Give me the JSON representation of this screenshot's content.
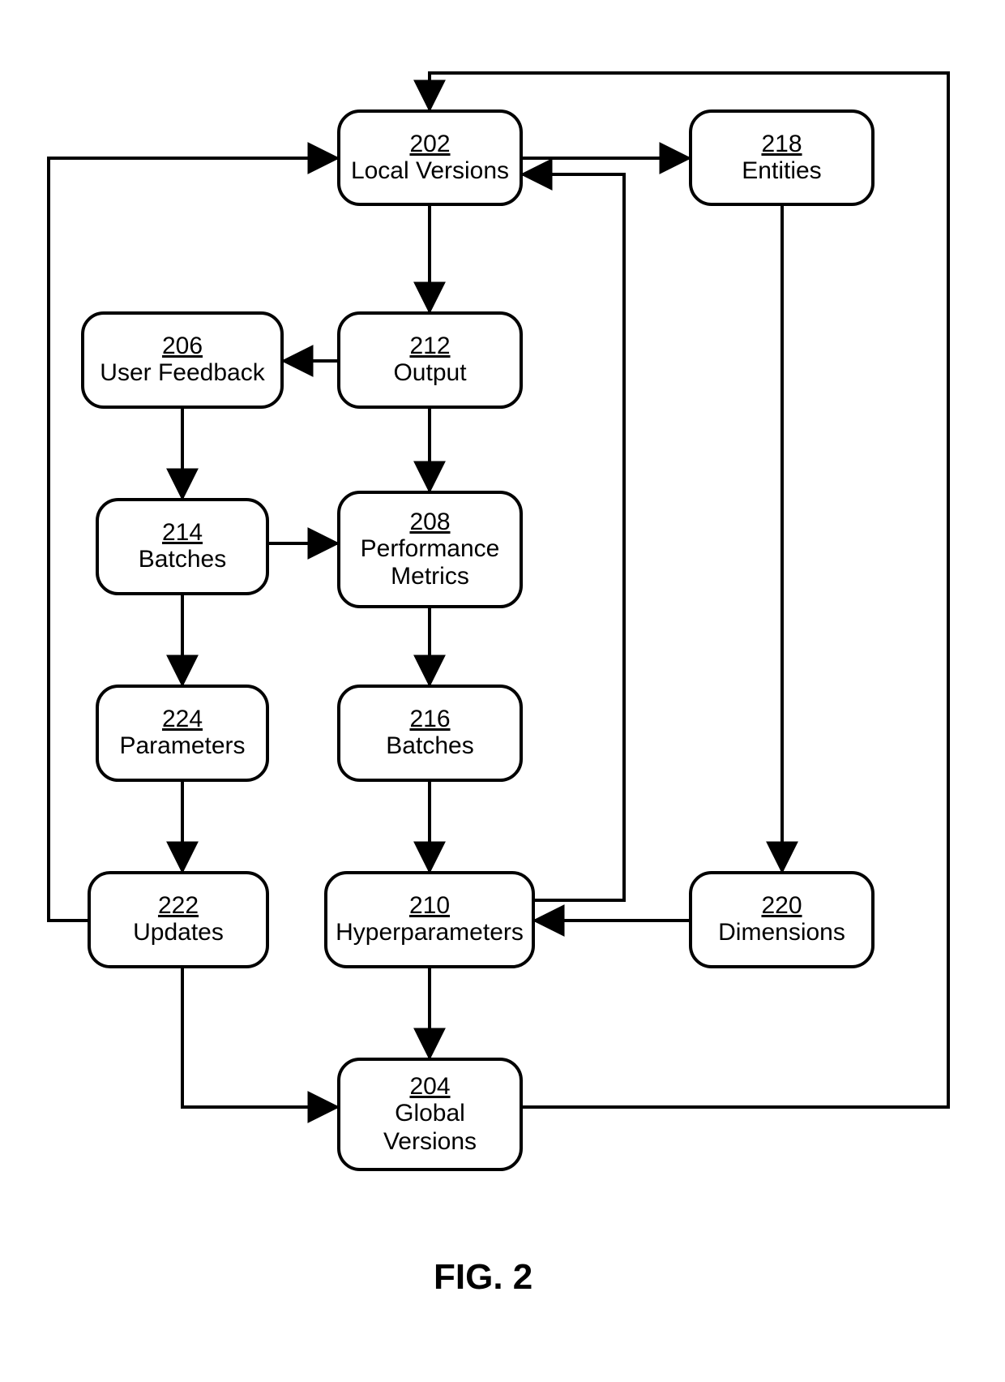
{
  "figure_caption": "FIG. 2",
  "nodes": {
    "n202": {
      "num": "202",
      "label": "Local Versions"
    },
    "n204": {
      "num": "204",
      "label": "Global\nVersions"
    },
    "n206": {
      "num": "206",
      "label": "User Feedback"
    },
    "n208": {
      "num": "208",
      "label": "Performance\nMetrics"
    },
    "n210": {
      "num": "210",
      "label": "Hyperparameters"
    },
    "n212": {
      "num": "212",
      "label": "Output"
    },
    "n214": {
      "num": "214",
      "label": "Batches"
    },
    "n216": {
      "num": "216",
      "label": "Batches"
    },
    "n218": {
      "num": "218",
      "label": "Entities"
    },
    "n220": {
      "num": "220",
      "label": "Dimensions"
    },
    "n222": {
      "num": "222",
      "label": "Updates"
    },
    "n224": {
      "num": "224",
      "label": "Parameters"
    }
  },
  "edges": [
    {
      "from": "202",
      "to": "218"
    },
    {
      "from": "202",
      "to": "212"
    },
    {
      "from": "212",
      "to": "206"
    },
    {
      "from": "212",
      "to": "208"
    },
    {
      "from": "206",
      "to": "214"
    },
    {
      "from": "214",
      "to": "208"
    },
    {
      "from": "214",
      "to": "224"
    },
    {
      "from": "208",
      "to": "216"
    },
    {
      "from": "224",
      "to": "222"
    },
    {
      "from": "216",
      "to": "210"
    },
    {
      "from": "218",
      "to": "220"
    },
    {
      "from": "220",
      "to": "210"
    },
    {
      "from": "210",
      "to": "202"
    },
    {
      "from": "210",
      "to": "204"
    },
    {
      "from": "222",
      "to": "204"
    },
    {
      "from": "222",
      "to": "202"
    },
    {
      "from": "204",
      "to": "202"
    }
  ]
}
